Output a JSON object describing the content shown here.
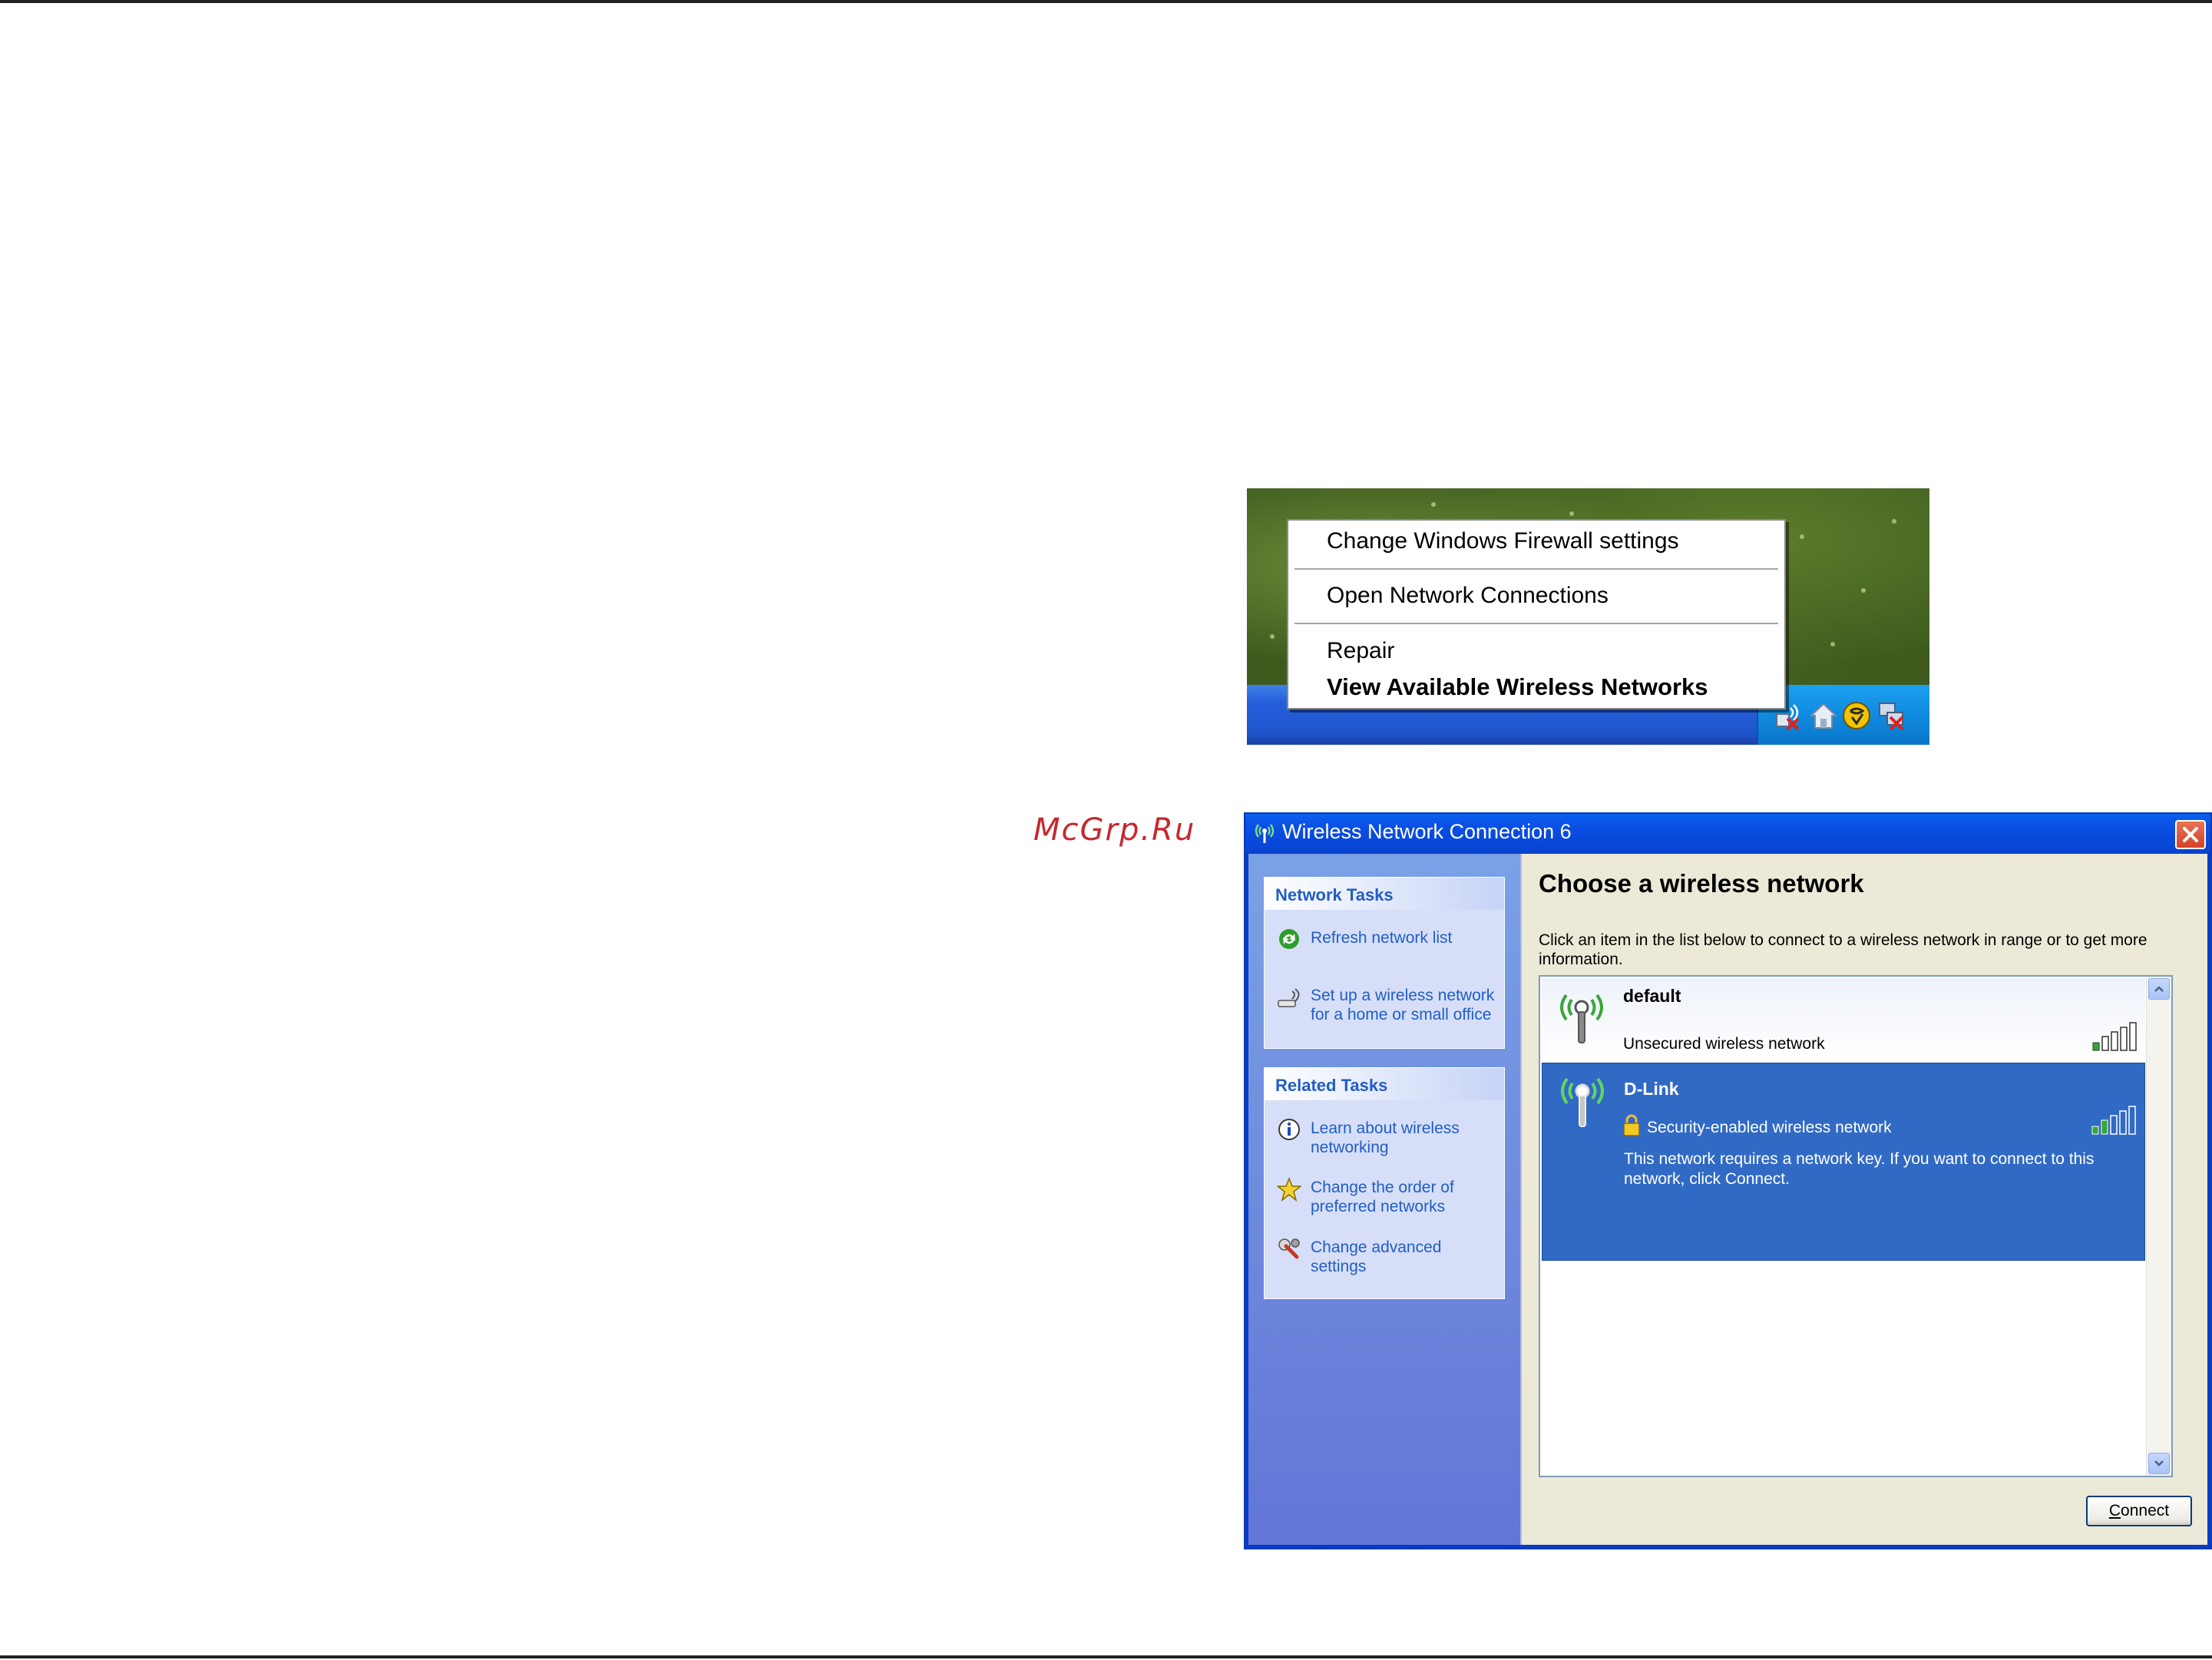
{
  "watermark": "McGrp.Ru",
  "tray_menu": {
    "items": [
      {
        "label": "Change Windows Firewall settings",
        "bold": false
      },
      {
        "label": "Open Network Connections",
        "bold": false
      },
      {
        "label": "Repair",
        "bold": false
      },
      {
        "label": "View Available Wireless Networks",
        "bold": true
      }
    ],
    "tray_icons": [
      "wireless-disconnected-icon",
      "home-network-icon",
      "security-center-icon",
      "network-disconnected-icon"
    ]
  },
  "dialog": {
    "title": "Wireless Network Connection 6",
    "network_tasks": {
      "heading": "Network Tasks",
      "links": [
        {
          "label": "Refresh network list",
          "icon": "refresh-icon"
        },
        {
          "label": "Set up a wireless network for a home or small office",
          "icon": "setup-wireless-icon"
        }
      ]
    },
    "related_tasks": {
      "heading": "Related Tasks",
      "links": [
        {
          "label": "Learn about wireless networking",
          "icon": "info-icon"
        },
        {
          "label": "Change the order of preferred networks",
          "icon": "star-icon"
        },
        {
          "label": "Change advanced settings",
          "icon": "wrench-icon"
        }
      ]
    },
    "heading": "Choose a wireless network",
    "description": "Click an item in the list below to connect to a wireless network in range or to get more information.",
    "networks": [
      {
        "name": "default",
        "status": "Unsecured wireless network",
        "secured": false,
        "selected": false,
        "signal_bars": 1,
        "detail": ""
      },
      {
        "name": "D-Link",
        "status": "Security-enabled wireless network",
        "secured": true,
        "selected": true,
        "signal_bars": 2,
        "detail": "This network requires a network key. If you want to connect to this network, click Connect."
      }
    ],
    "connect_prefix": "C",
    "connect_rest": "onnect"
  },
  "colors": {
    "title_bar": "#0a4de0",
    "task_link": "#215dc6",
    "selected_row": "#316ac5",
    "watermark": "#c6272e"
  }
}
